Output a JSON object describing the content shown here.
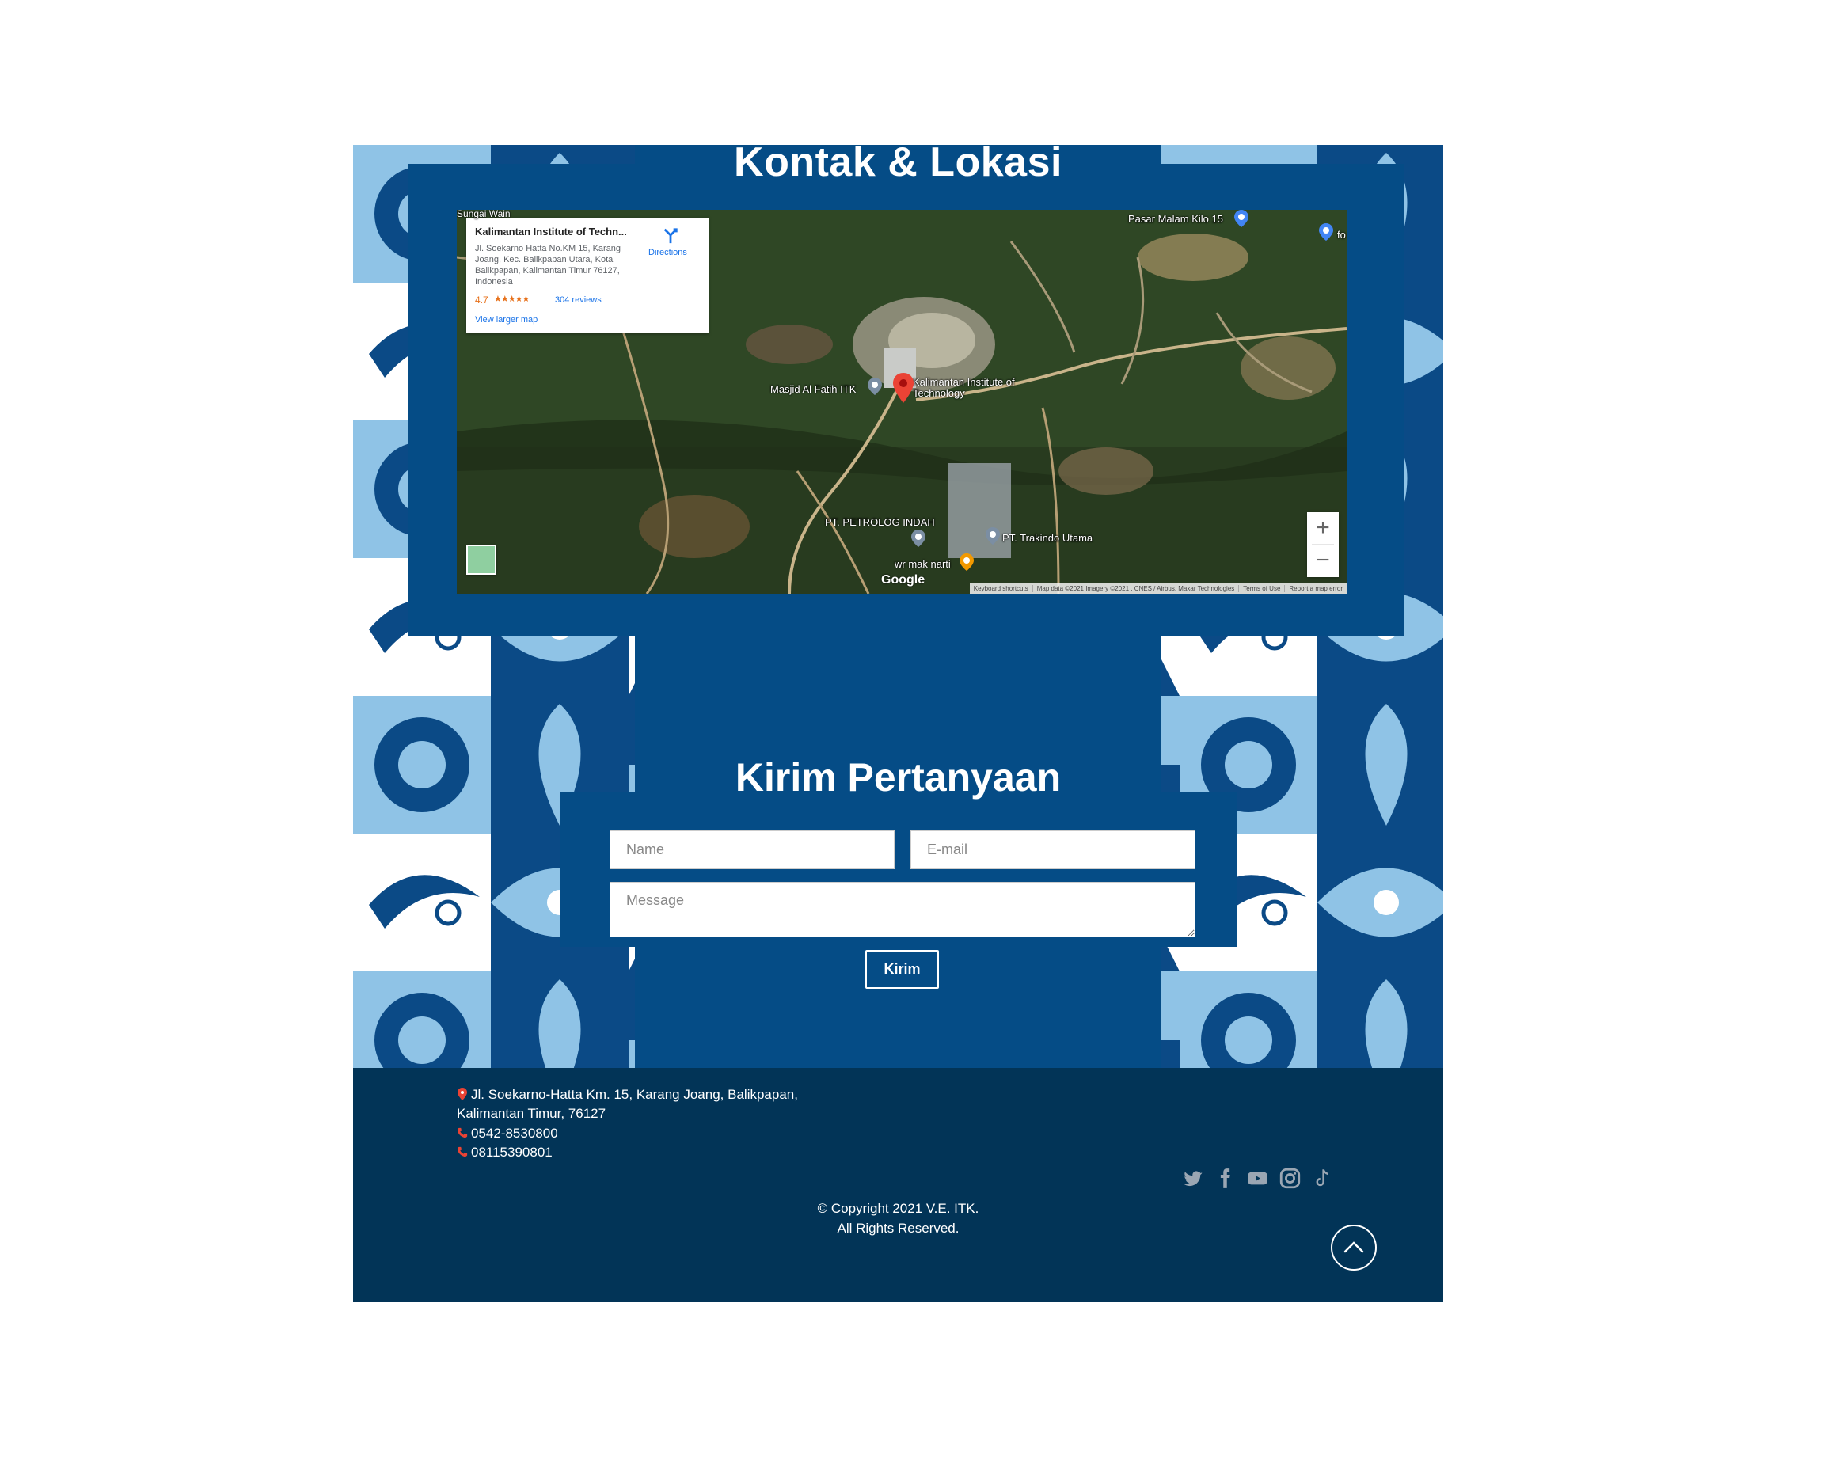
{
  "contact": {
    "title": "Kontak & Lokasi"
  },
  "map": {
    "card_title": "Kalimantan Institute of Techn...",
    "card_address": "Jl. Soekarno Hatta No.KM 15, Karang Joang, Kec. Balikpapan Utara, Kota Balikpapan, Kalimantan Timur 76127, Indonesia",
    "rating": "4.7",
    "stars": "★★★★★",
    "reviews": "304 reviews",
    "view_larger": "View larger map",
    "directions": "Directions",
    "labels": {
      "sungai_wain": "Sungai Wain",
      "pasar_malam": "Pasar Malam Kilo 15",
      "fo": "fo",
      "masjid": "Masjid Al Fatih ITK",
      "itk": "Kalimantan Institute of Technology",
      "petrolog": "PT. PETROLOG INDAH",
      "trakindo": "PT. Trakindo Utama",
      "mak_narti": "wr mak narti"
    },
    "zoom_in": "+",
    "zoom_out": "−",
    "google": "Google",
    "footer": {
      "shortcuts": "Keyboard shortcuts",
      "data": "Map data ©2021 Imagery ©2021 , CNES / Airbus, Maxar Technologies",
      "terms": "Terms of Use",
      "report": "Report a map error"
    }
  },
  "question": {
    "title": "Kirim Pertanyaan",
    "name_placeholder": "Name",
    "email_placeholder": "E-mail",
    "message_placeholder": "Message",
    "send_label": "Kirim"
  },
  "footer": {
    "address_line1": "Jl. Soekarno-Hatta Km. 15, Karang Joang, Balikpapan,",
    "address_line2": "Kalimantan Timur, 76127",
    "phone1": "0542-8530800",
    "phone2": "08115390801",
    "copyright_line1": "© Copyright 2021 V.E. ITK.",
    "copyright_line2": "All Rights Reserved.",
    "social_icons": [
      "twitter-icon",
      "facebook-icon",
      "youtube-icon",
      "instagram-icon",
      "tiktok-icon"
    ]
  },
  "colors": {
    "primary_blue": "#054c86",
    "footer_navy": "#023457",
    "batik_light": "#8fc3e6",
    "batik_dark": "#0b4a86",
    "pin_red": "#ea4335"
  }
}
